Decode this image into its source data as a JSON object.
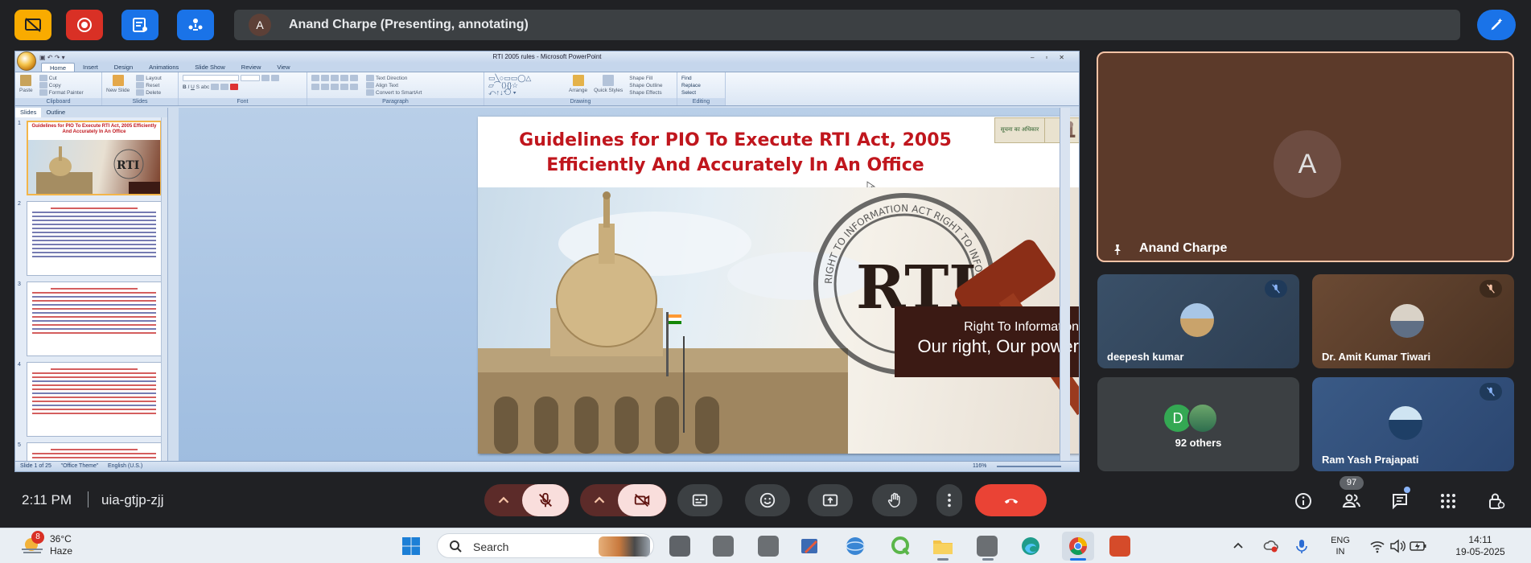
{
  "presenter": {
    "avatar_letter": "A",
    "banner": "Anand Charpe (Presenting, annotating)"
  },
  "ppt": {
    "window_title": "RTI 2005 rules - Microsoft PowerPoint",
    "tabs": [
      "Home",
      "Insert",
      "Design",
      "Animations",
      "Slide Show",
      "Review",
      "View"
    ],
    "ribbon_groups": [
      {
        "label": "Clipboard",
        "items": [
          "Paste",
          "Cut",
          "Copy",
          "Format Painter"
        ]
      },
      {
        "label": "Slides",
        "items": [
          "New Slide",
          "Layout",
          "Reset",
          "Delete"
        ]
      },
      {
        "label": "Font",
        "items": []
      },
      {
        "label": "Paragraph",
        "items": [
          "Text Direction",
          "Align Text",
          "Convert to SmartArt"
        ]
      },
      {
        "label": "Drawing",
        "items": [
          "Arrange",
          "Quick Styles",
          "Shape Fill",
          "Shape Outline",
          "Shape Effects"
        ]
      },
      {
        "label": "Editing",
        "items": [
          "Find",
          "Replace",
          "Select"
        ]
      }
    ],
    "pane_tabs": [
      "Slides",
      "Outline"
    ],
    "thumb1_title": "Guidelines for PIO To Execute RTI Act, 2005 Efficiently And Accurately In An Office",
    "thumb_numbers": [
      "1",
      "2",
      "3",
      "4",
      "5"
    ],
    "slide": {
      "title_line1": "Guidelines for PIO To Execute RTI Act, 2005",
      "title_line2": "Efficiently And Accurately In An Office",
      "banner_line1": "Right To Information",
      "banner_line2": "Our right, Our power",
      "stamp_text": "RTI",
      "stamp_ring": "RIGHT TO INFORMATION ACT RIGHT TO INFORMATION ACT",
      "logo_text": "सूचना का अधिकार",
      "number": "1"
    },
    "status": {
      "slide": "Slide 1 of 25",
      "theme": "\"Office Theme\"",
      "language": "English (U.S.)",
      "zoom": "116%"
    }
  },
  "participants": {
    "main": {
      "name": "Anand Charpe",
      "letter": "A"
    },
    "tiles": [
      {
        "name": "deepesh kumar"
      },
      {
        "name": "Dr. Amit Kumar Tiwari"
      },
      {
        "name": "92 others",
        "letter": "D"
      },
      {
        "name": "Ram Yash Prajapati"
      }
    ]
  },
  "meeting": {
    "time": "2:11 PM",
    "code": "uia-gtjp-zjj",
    "people_count": "97"
  },
  "taskbar": {
    "weather_badge": "8",
    "temperature": "36°C",
    "condition": "Haze",
    "search_placeholder": "Search",
    "lang_line1": "ENG",
    "lang_line2": "IN",
    "clock_time": "14:11",
    "clock_date": "19-05-2025"
  },
  "colors": {
    "top_btn_yellow": "#f9ab00",
    "top_btn_red": "#d93025",
    "top_btn_blue": "#1a73e8",
    "end_call": "#ea4335",
    "muted_control": "#f9dedc"
  }
}
